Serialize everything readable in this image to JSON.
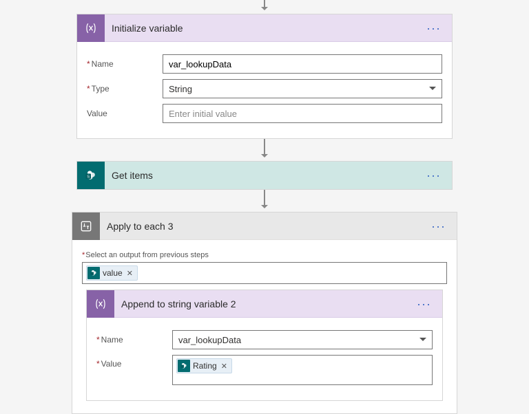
{
  "colors": {
    "variable_purple": "#8762a7",
    "sharepoint_teal": "#036c70",
    "header_purple": "#e9def2",
    "header_teal": "#cfe7e4",
    "required_red": "#a4262c"
  },
  "steps": {
    "init_var": {
      "title": "Initialize variable",
      "icon": "variable-icon",
      "fields": {
        "name_label": "Name",
        "name_value": "var_lookupData",
        "type_label": "Type",
        "type_value": "String",
        "value_label": "Value",
        "value_placeholder": "Enter initial value"
      }
    },
    "get_items": {
      "title": "Get items",
      "icon": "sharepoint-icon"
    },
    "apply_each": {
      "title": "Apply to each 3",
      "icon": "loop-icon",
      "select_hint": "Select an output from previous steps",
      "select_token": "value"
    },
    "append_var": {
      "title": "Append to string variable 2",
      "icon": "variable-icon",
      "fields": {
        "name_label": "Name",
        "name_value": "var_lookupData",
        "value_label": "Value",
        "value_token": "Rating"
      }
    }
  }
}
